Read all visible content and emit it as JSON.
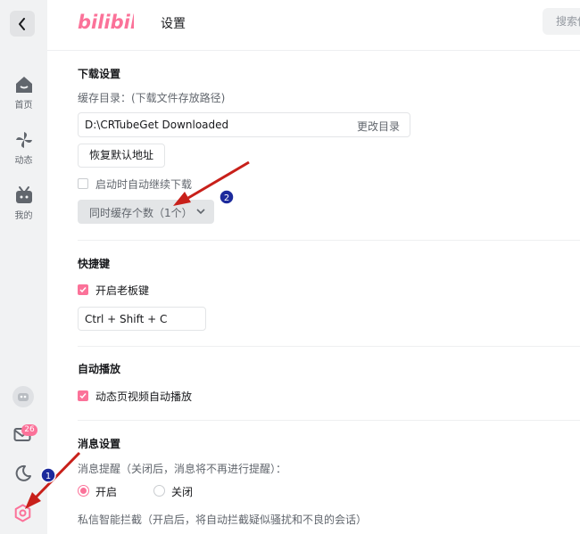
{
  "app": {
    "logo_text": "bilibili",
    "page_title": "设置",
    "search_placeholder": "搜索你"
  },
  "sidebar": {
    "items": [
      {
        "label": "首页",
        "icon": "home-icon"
      },
      {
        "label": "动态",
        "icon": "windmill-icon"
      },
      {
        "label": "我的",
        "icon": "tv-icon"
      }
    ],
    "message_badge": "26"
  },
  "download": {
    "title": "下载设置",
    "cache_dir_label": "缓存目录：(下载文件存放路径)",
    "cache_dir_value": "D:\\CRTubeGet Downloaded",
    "change_dir_label": "更改目录",
    "restore_default_label": "恢复默认地址",
    "auto_resume_label": "启动时自动继续下载",
    "auto_resume_checked": false,
    "concurrent_label": "同时缓存个数（1个）"
  },
  "hotkeys": {
    "title": "快捷键",
    "boss_key_label": "开启老板键",
    "boss_key_checked": true,
    "boss_key_value": "Ctrl + Shift + C"
  },
  "autoplay": {
    "title": "自动播放",
    "feed_autoplay_label": "动态页视频自动播放",
    "feed_autoplay_checked": true
  },
  "messages": {
    "title": "消息设置",
    "reminder_label": "消息提醒（关闭后，消息将不再进行提醒）：",
    "on_label": "开启",
    "off_label": "关闭",
    "selected": "开启",
    "dm_filter_label": "私信智能拦截（开启后，将自动拦截疑似骚扰和不良的会话）"
  },
  "annotations": {
    "marker_1": "1",
    "marker_2": "2",
    "arrow_color": "#c8201a",
    "marker_color": "#1c2a9c"
  },
  "colors": {
    "accent": "#fb7299",
    "sidebar_bg": "#f1f2f3"
  }
}
